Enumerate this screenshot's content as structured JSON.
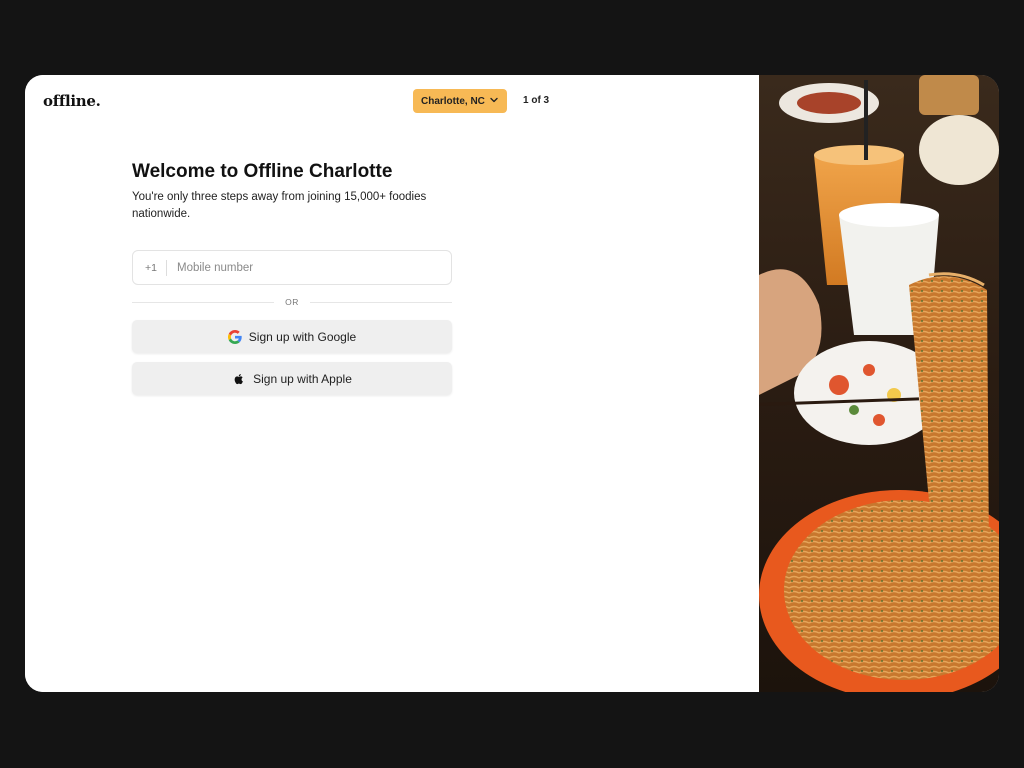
{
  "header": {
    "logo": "offline.",
    "city": "Charlotte, NC",
    "step": "1 of 3"
  },
  "main": {
    "title": "Welcome to Offline Charlotte",
    "subtitle": "You're only three steps away from joining 15,000+ foodies nationwide.",
    "phone": {
      "country_code": "+1",
      "placeholder": "Mobile number",
      "value": ""
    },
    "divider_text": "OR",
    "google_label": "Sign up with Google",
    "apple_label": "Sign up with Apple"
  },
  "icons": {
    "city_chevron": "chevron-down-icon",
    "google": "google-icon",
    "apple": "apple-icon"
  },
  "colors": {
    "page_background": "#141414",
    "city_button": "#f7b955",
    "social_button": "#efefef",
    "text": "#111111"
  }
}
